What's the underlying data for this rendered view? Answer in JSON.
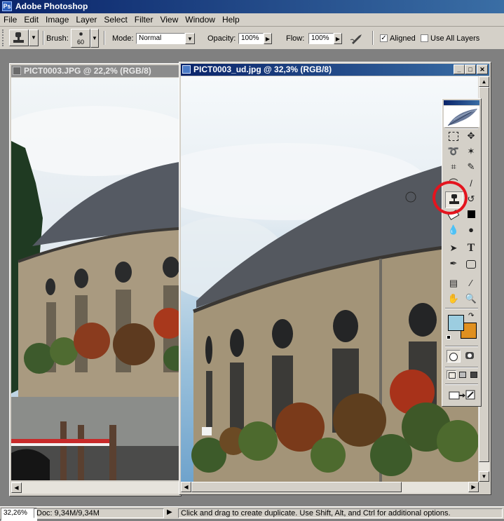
{
  "app": {
    "title": "Adobe Photoshop",
    "logo": "Ps"
  },
  "menu": [
    "File",
    "Edit",
    "Image",
    "Layer",
    "Select",
    "Filter",
    "View",
    "Window",
    "Help"
  ],
  "options": {
    "brush_label": "Brush:",
    "brush_size": "60",
    "mode_label": "Mode:",
    "mode_value": "Normal",
    "opacity_label": "Opacity:",
    "opacity_value": "100%",
    "flow_label": "Flow:",
    "flow_value": "100%",
    "aligned_label": "Aligned",
    "aligned_checked": true,
    "all_layers_label": "Use All Layers",
    "all_layers_checked": false
  },
  "documents": [
    {
      "title": "PICT0003.JPG @ 22,2% (RGB/8)",
      "active": false
    },
    {
      "title": "PICT0003_ud.jpg @ 32,3% (RGB/8)",
      "active": true
    }
  ],
  "toolbox": {
    "selected_tool": "clone-stamp-tool",
    "highlight_color": "#e4141e",
    "foreground_color": "#9ccde0",
    "background_color": "#e09020"
  },
  "status": {
    "zoom": "32,26%",
    "doc_info": "Doc: 9,34M/9,34M",
    "hint": "Click and drag to create duplicate.  Use Shift, Alt, and Ctrl for additional options."
  }
}
